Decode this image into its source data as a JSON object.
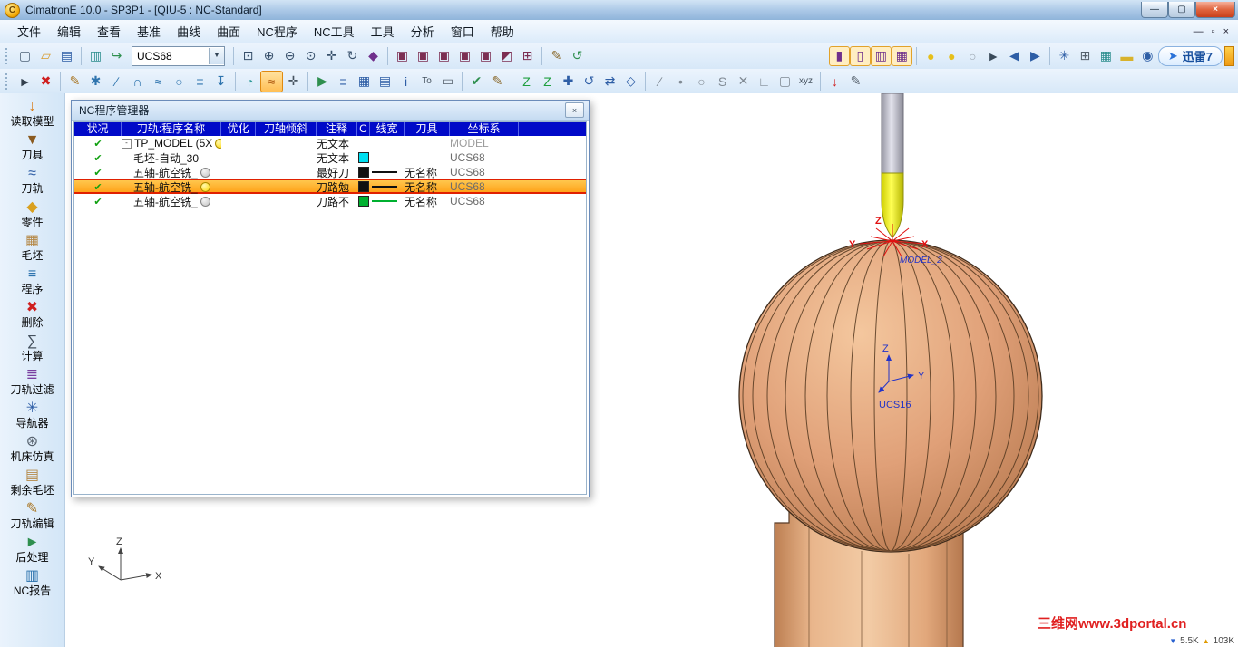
{
  "window": {
    "title": "CimatronE 10.0 - SP3P1 - [QIU-5 : NC-Standard]",
    "logo_glyph": "C",
    "controls": {
      "minimize": "—",
      "restore": "▢",
      "close": "×"
    }
  },
  "menu": {
    "items": [
      "文件",
      "编辑",
      "查看",
      "基准",
      "曲线",
      "曲面",
      "NC程序",
      "NC工具",
      "工具",
      "分析",
      "窗口",
      "帮助"
    ],
    "mdi": {
      "minimize": "—",
      "restore": "▫",
      "close": "×"
    }
  },
  "toolbars": {
    "ucs_selector": {
      "value": "UCS68",
      "arrow": "▼"
    },
    "thunder": {
      "label": "迅雷7",
      "glyph": "➤"
    },
    "row1_left": [
      {
        "name": "new-file-icon",
        "glyph": "▢",
        "color": "#51657a"
      },
      {
        "name": "open-folder-icon",
        "glyph": "▱",
        "color": "#d89a2c"
      },
      {
        "name": "save-icon",
        "glyph": "▤",
        "color": "#2e5ea6"
      },
      {
        "type": "sep"
      },
      {
        "name": "screen-layout-icon",
        "glyph": "▥",
        "color": "#2e8f8f"
      },
      {
        "name": "ucs-swap-icon",
        "glyph": "↪",
        "color": "#2e8f4e"
      }
    ],
    "row1_right": [
      {
        "type": "sep"
      },
      {
        "name": "zoom-window-icon",
        "glyph": "⊡",
        "color": "#38506b"
      },
      {
        "name": "zoom-in-icon",
        "glyph": "⊕",
        "color": "#38506b"
      },
      {
        "name": "zoom-out-icon",
        "glyph": "⊖",
        "color": "#38506b"
      },
      {
        "name": "zoom-all-icon",
        "glyph": "⊙",
        "color": "#38506b"
      },
      {
        "name": "pan-icon",
        "glyph": "✛",
        "color": "#38506b"
      },
      {
        "name": "dynamic-rotate-icon",
        "glyph": "↻",
        "color": "#38506b"
      },
      {
        "name": "orbit-icon",
        "glyph": "◆",
        "color": "#70308c"
      },
      {
        "type": "sep"
      },
      {
        "name": "view-iso-icon",
        "glyph": "▣",
        "color": "#7c2e52"
      },
      {
        "name": "view-front-icon",
        "glyph": "▣",
        "color": "#7c2e52"
      },
      {
        "name": "view-top-icon",
        "glyph": "▣",
        "color": "#7c2e52"
      },
      {
        "name": "view-right-icon",
        "glyph": "▣",
        "color": "#7c2e52"
      },
      {
        "name": "view-back-icon",
        "glyph": "▣",
        "color": "#7c2e52"
      },
      {
        "name": "view-bottom-icon",
        "glyph": "◩",
        "color": "#7c2e52"
      },
      {
        "name": "saved-views-icon",
        "glyph": "⊞",
        "color": "#7c2e52"
      },
      {
        "type": "sep"
      },
      {
        "name": "redraw-icon",
        "glyph": "✎",
        "color": "#8a6a2e"
      },
      {
        "name": "regenerate-icon",
        "glyph": "↺",
        "color": "#2e8f4e"
      },
      {
        "type": "spacer"
      },
      {
        "name": "shaded-mode-icon",
        "glyph": "▮",
        "color": "#70308c",
        "framed": true
      },
      {
        "name": "wireframe-mode-icon",
        "glyph": "▯",
        "color": "#70308c",
        "framed": true
      },
      {
        "name": "hidden-line-mode-icon",
        "glyph": "▥",
        "color": "#70308c",
        "framed": true
      },
      {
        "name": "transparency-mode-icon",
        "glyph": "▦",
        "color": "#70308c",
        "framed": true
      },
      {
        "type": "sep"
      },
      {
        "name": "light-bulb-on-icon",
        "glyph": "●",
        "color": "#e6bf1a"
      },
      {
        "name": "light-bulb-on2-icon",
        "glyph": "●",
        "color": "#e6bf1a"
      },
      {
        "name": "light-bulb-off-icon",
        "glyph": "○",
        "color": "#98a2ac"
      },
      {
        "name": "pick-arrow-icon",
        "glyph": "►",
        "color": "#3a4a5a"
      },
      {
        "name": "undo-view-icon",
        "glyph": "◀",
        "color": "#2e5ea6"
      },
      {
        "name": "redo-view-icon",
        "glyph": "▶",
        "color": "#2e5ea6"
      },
      {
        "type": "sep"
      },
      {
        "name": "navigator-star-icon",
        "glyph": "✳",
        "color": "#2e5ea6"
      },
      {
        "name": "calculator-icon",
        "glyph": "⊞",
        "color": "#55606c"
      },
      {
        "name": "grid-icon",
        "glyph": "▦",
        "color": "#2e8f8f"
      },
      {
        "name": "note-icon",
        "glyph": "▬",
        "color": "#d8b22c"
      },
      {
        "name": "preview-eye-icon",
        "glyph": "◉",
        "color": "#2e5ea6"
      }
    ],
    "row2": [
      {
        "name": "pick-icon",
        "glyph": "►",
        "color": "#33404e"
      },
      {
        "name": "delete-pick-icon",
        "glyph": "✖",
        "color": "#cf1f1f"
      },
      {
        "type": "sep"
      },
      {
        "name": "sketcher-icon",
        "glyph": "✎",
        "color": "#a87420"
      },
      {
        "name": "point-icon",
        "glyph": "✱",
        "color": "#2e74ae"
      },
      {
        "name": "line-icon",
        "glyph": "∕",
        "color": "#2e74ae"
      },
      {
        "name": "arc-icon",
        "glyph": "∩",
        "color": "#2e74ae"
      },
      {
        "name": "spline-icon",
        "glyph": "≈",
        "color": "#2e74ae"
      },
      {
        "name": "circle-icon",
        "glyph": "○",
        "color": "#2e74ae"
      },
      {
        "name": "offset-curve-icon",
        "glyph": "≡",
        "color": "#2e74ae"
      },
      {
        "name": "project-curve-icon",
        "glyph": "↧",
        "color": "#2e74ae"
      },
      {
        "type": "sep"
      },
      {
        "name": "surface-icon",
        "glyph": "◔",
        "color": "#2e9a9a"
      },
      {
        "name": "active-curve-icon",
        "glyph": "≈",
        "color": "#b05a10",
        "selected": true
      },
      {
        "name": "measure-icon",
        "glyph": "✛",
        "color": "#45525f"
      },
      {
        "type": "sep"
      },
      {
        "name": "simulator-icon",
        "glyph": "▶",
        "color": "#2e8f4e"
      },
      {
        "name": "program-list-icon",
        "glyph": "≡",
        "color": "#2e5ea6"
      },
      {
        "name": "ops-table-icon",
        "glyph": "▦",
        "color": "#2e5ea6"
      },
      {
        "name": "tool-list-icon",
        "glyph": "▤",
        "color": "#2e5ea6"
      },
      {
        "name": "info-icon",
        "glyph": "i",
        "color": "#2e5ea6"
      },
      {
        "name": "tool-table-icon",
        "glyph": "To",
        "color": "#45525f"
      },
      {
        "name": "print-icon",
        "glyph": "▭",
        "color": "#55606c"
      },
      {
        "type": "sep"
      },
      {
        "name": "verify-icon",
        "glyph": "✔",
        "color": "#2e8f4e"
      },
      {
        "name": "annotate-icon",
        "glyph": "✎",
        "color": "#8a6a2e"
      },
      {
        "type": "sep"
      },
      {
        "name": "z-top-icon",
        "glyph": "Z",
        "color": "#1f9f3f"
      },
      {
        "name": "z-bottom-icon",
        "glyph": "Z",
        "color": "#1f9f3f"
      },
      {
        "name": "move-icon",
        "glyph": "✚",
        "color": "#2e5ea6"
      },
      {
        "name": "rotate-copy-icon",
        "glyph": "↺",
        "color": "#2e5ea6"
      },
      {
        "name": "mirror-icon",
        "glyph": "⇄",
        "color": "#2e5ea6"
      },
      {
        "name": "scale-icon",
        "glyph": "◇",
        "color": "#2e5ea6"
      },
      {
        "type": "sep"
      },
      {
        "name": "edge-icon",
        "glyph": "∕",
        "color": "#808a94"
      },
      {
        "name": "vertex-icon",
        "glyph": "•",
        "color": "#808a94"
      },
      {
        "name": "circle-ref-icon",
        "glyph": "○",
        "color": "#808a94"
      },
      {
        "name": "curve-ref-icon",
        "glyph": "S",
        "color": "#808a94"
      },
      {
        "name": "intersect-icon",
        "glyph": "✕",
        "color": "#808a94"
      },
      {
        "name": "corner-icon",
        "glyph": "∟",
        "color": "#808a94"
      },
      {
        "name": "frame-icon",
        "glyph": "▢",
        "color": "#808a94"
      },
      {
        "name": "xyz-icon",
        "glyph": "xyz",
        "color": "#45525f"
      },
      {
        "type": "sep"
      },
      {
        "name": "export-red-icon",
        "glyph": "↓",
        "color": "#cf1f1f"
      },
      {
        "name": "pen-style-icon",
        "glyph": "✎",
        "color": "#55606c"
      }
    ]
  },
  "sidebar": {
    "items": [
      {
        "id": "read-model",
        "label": "读取模型",
        "icon": "read-model-icon",
        "glyph": "↓",
        "color": "#d9780f"
      },
      {
        "id": "cutter",
        "label": "刀具",
        "icon": "cutter-icon",
        "glyph": "▼",
        "color": "#8a5a20"
      },
      {
        "id": "toolpath",
        "label": "刀轨",
        "icon": "toolpath-icon",
        "glyph": "≈",
        "color": "#2e5ea6"
      },
      {
        "id": "part",
        "label": "零件",
        "icon": "part-icon",
        "glyph": "◆",
        "color": "#d9a01f"
      },
      {
        "id": "stock",
        "label": "毛坯",
        "icon": "stock-icon",
        "glyph": "▦",
        "color": "#b58a4a"
      },
      {
        "id": "procedure",
        "label": "程序",
        "icon": "procedure-icon",
        "glyph": "≡",
        "color": "#2e74ae"
      },
      {
        "id": "delete",
        "label": "删除",
        "icon": "delete-icon",
        "glyph": "✖",
        "color": "#cf1f1f"
      },
      {
        "id": "calculate",
        "label": "计算",
        "icon": "calculate-icon",
        "glyph": "∑",
        "color": "#45525f"
      },
      {
        "id": "toolpath-filter",
        "label": "刀轨过滤",
        "icon": "toolpath-filter-icon",
        "glyph": "≣",
        "color": "#7a3fa0"
      },
      {
        "id": "navigator",
        "label": "导航器",
        "icon": "navigator-icon",
        "glyph": "✳",
        "color": "#2e5ea6"
      },
      {
        "id": "machine-sim",
        "label": "机床仿真",
        "icon": "machine-sim-icon",
        "glyph": "⊛",
        "color": "#55606c"
      },
      {
        "id": "rest-stock",
        "label": "剩余毛坯",
        "icon": "rest-stock-icon",
        "glyph": "▤",
        "color": "#b58a4a"
      },
      {
        "id": "toolpath-edit",
        "label": "刀轨编辑",
        "icon": "toolpath-edit-icon",
        "glyph": "✎",
        "color": "#a87420"
      },
      {
        "id": "post-process",
        "label": "后处理",
        "icon": "post-process-icon",
        "glyph": "►",
        "color": "#2e8f4e"
      },
      {
        "id": "nc-report",
        "label": "NC报告",
        "icon": "nc-report-icon",
        "glyph": "▥",
        "color": "#2e74ae"
      }
    ]
  },
  "panel": {
    "title": "NC程序管理器",
    "close_glyph": "×",
    "check_glyph": "✔",
    "expander_glyph": "-",
    "columns": [
      "状况",
      "刀轨:程序名称",
      "优化",
      "刀轴倾斜",
      "注释",
      "C",
      "线宽",
      "刀具",
      "坐标系"
    ],
    "rows": [
      {
        "check": true,
        "expand": true,
        "indent": 0,
        "name": "TP_MODEL (5X",
        "bulb": "yellow",
        "comment": "无文本",
        "swatch": null,
        "line": null,
        "tool": "",
        "cs": "MODEL",
        "cs_dim": true,
        "selected": false
      },
      {
        "check": true,
        "expand": false,
        "indent": 1,
        "name": "毛坯-自动_30",
        "bulb": null,
        "comment": "无文本",
        "swatch": "#00dff0",
        "line": null,
        "tool": "",
        "cs": "UCS68",
        "cs_dim": false,
        "selected": false
      },
      {
        "check": true,
        "expand": false,
        "indent": 1,
        "name": "五轴-航空铣_",
        "bulb": "gray",
        "comment": "最好刀",
        "swatch": "#101010",
        "line": "#101010",
        "tool": "无名称",
        "cs": "UCS68",
        "cs_dim": false,
        "selected": false
      },
      {
        "check": true,
        "expand": false,
        "indent": 1,
        "name": "五轴-航空铣_",
        "bulb": "yellow",
        "comment": "刀路勉",
        "swatch": "#101010",
        "line": "#101010",
        "tool": "无名称",
        "cs": "UCS68",
        "cs_dim": false,
        "selected": true
      },
      {
        "check": true,
        "expand": false,
        "indent": 1,
        "name": "五轴-航空铣_",
        "bulb": "gray",
        "comment": "刀路不",
        "swatch": "#00b030",
        "line": "#00b030",
        "tool": "无名称",
        "cs": "UCS68",
        "cs_dim": false,
        "selected": false
      }
    ]
  },
  "viewport": {
    "labels": {
      "tool_z": "Z",
      "tool_y": "Y",
      "tool_x": "X",
      "model_tag": "MODEL_2",
      "center_z": "Z",
      "center_y": "Y",
      "center_ucs": "UCS16",
      "triad_x": "X",
      "triad_y": "Y",
      "triad_z": "Z",
      "watermark": "三维网www.3dportal.cn"
    },
    "status": {
      "down": "5.5K",
      "up": "103K"
    }
  }
}
